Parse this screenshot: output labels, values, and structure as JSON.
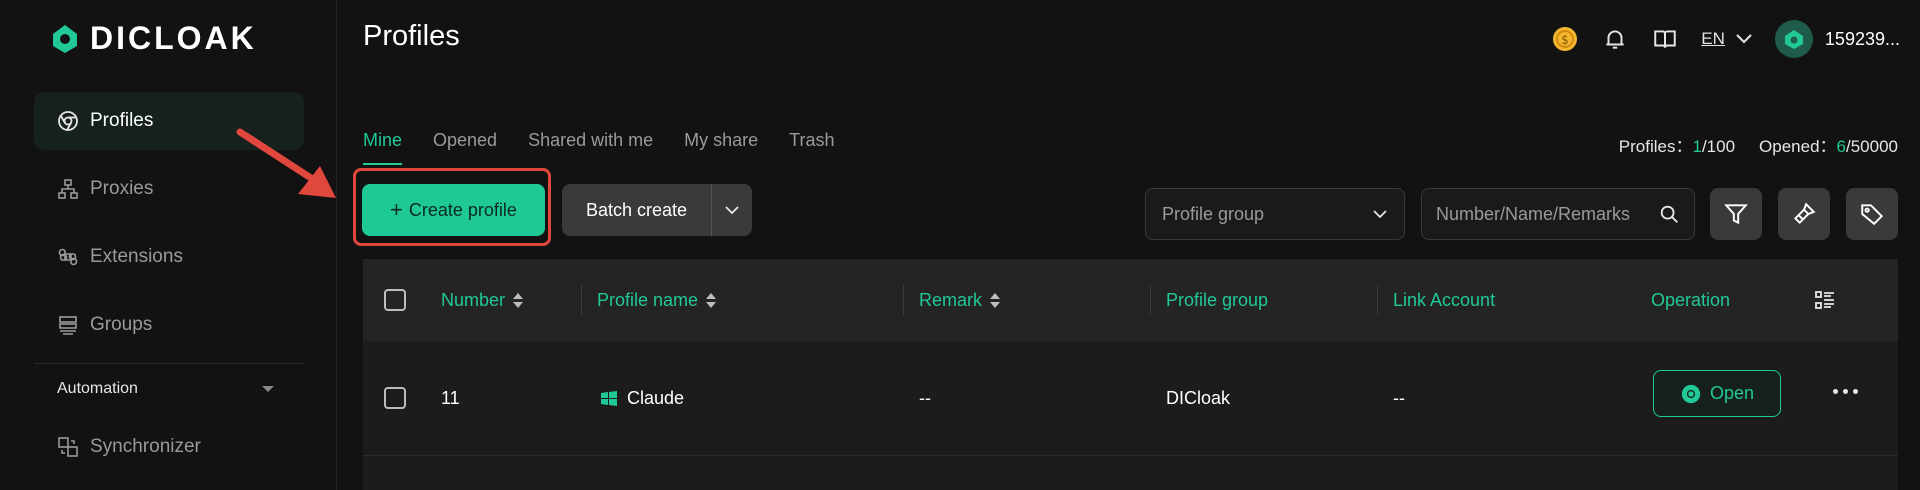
{
  "brand": {
    "name": "DICLOAK",
    "accent": "#20c997"
  },
  "sidebar": {
    "items": [
      {
        "label": "Profiles",
        "icon": "chrome-icon",
        "active": true
      },
      {
        "label": "Proxies",
        "icon": "network-icon",
        "active": false
      },
      {
        "label": "Extensions",
        "icon": "command-icon",
        "active": false
      },
      {
        "label": "Groups",
        "icon": "layers-icon",
        "active": false
      }
    ],
    "section_label": "Automation",
    "automation_items": [
      {
        "label": "Synchronizer",
        "icon": "sync-windows-icon"
      }
    ]
  },
  "header": {
    "title": "Profiles",
    "language": "EN",
    "user_name": "159239..."
  },
  "tabs": [
    {
      "label": "Mine",
      "active": true
    },
    {
      "label": "Opened",
      "active": false
    },
    {
      "label": "Shared with me",
      "active": false
    },
    {
      "label": "My share",
      "active": false
    },
    {
      "label": "Trash",
      "active": false
    }
  ],
  "counts": {
    "profiles_label": "Profiles：",
    "profiles_used": "1",
    "profiles_total": "/100",
    "opened_label": "Opened：",
    "opened_used": "6",
    "opened_total": "/50000"
  },
  "toolbar": {
    "create_label": "Create profile",
    "create_plus": "+",
    "batch_label": "Batch create",
    "group_placeholder": "Profile group",
    "search_placeholder": "Number/Name/Remarks"
  },
  "table": {
    "columns": [
      "Number",
      "Profile name",
      "Remark",
      "Profile group",
      "Link Account",
      "Operation"
    ],
    "rows": [
      {
        "number": "11",
        "name": "Claude",
        "remark": "--",
        "group": "DICloak",
        "link_account": "--",
        "action": "Open"
      }
    ]
  }
}
